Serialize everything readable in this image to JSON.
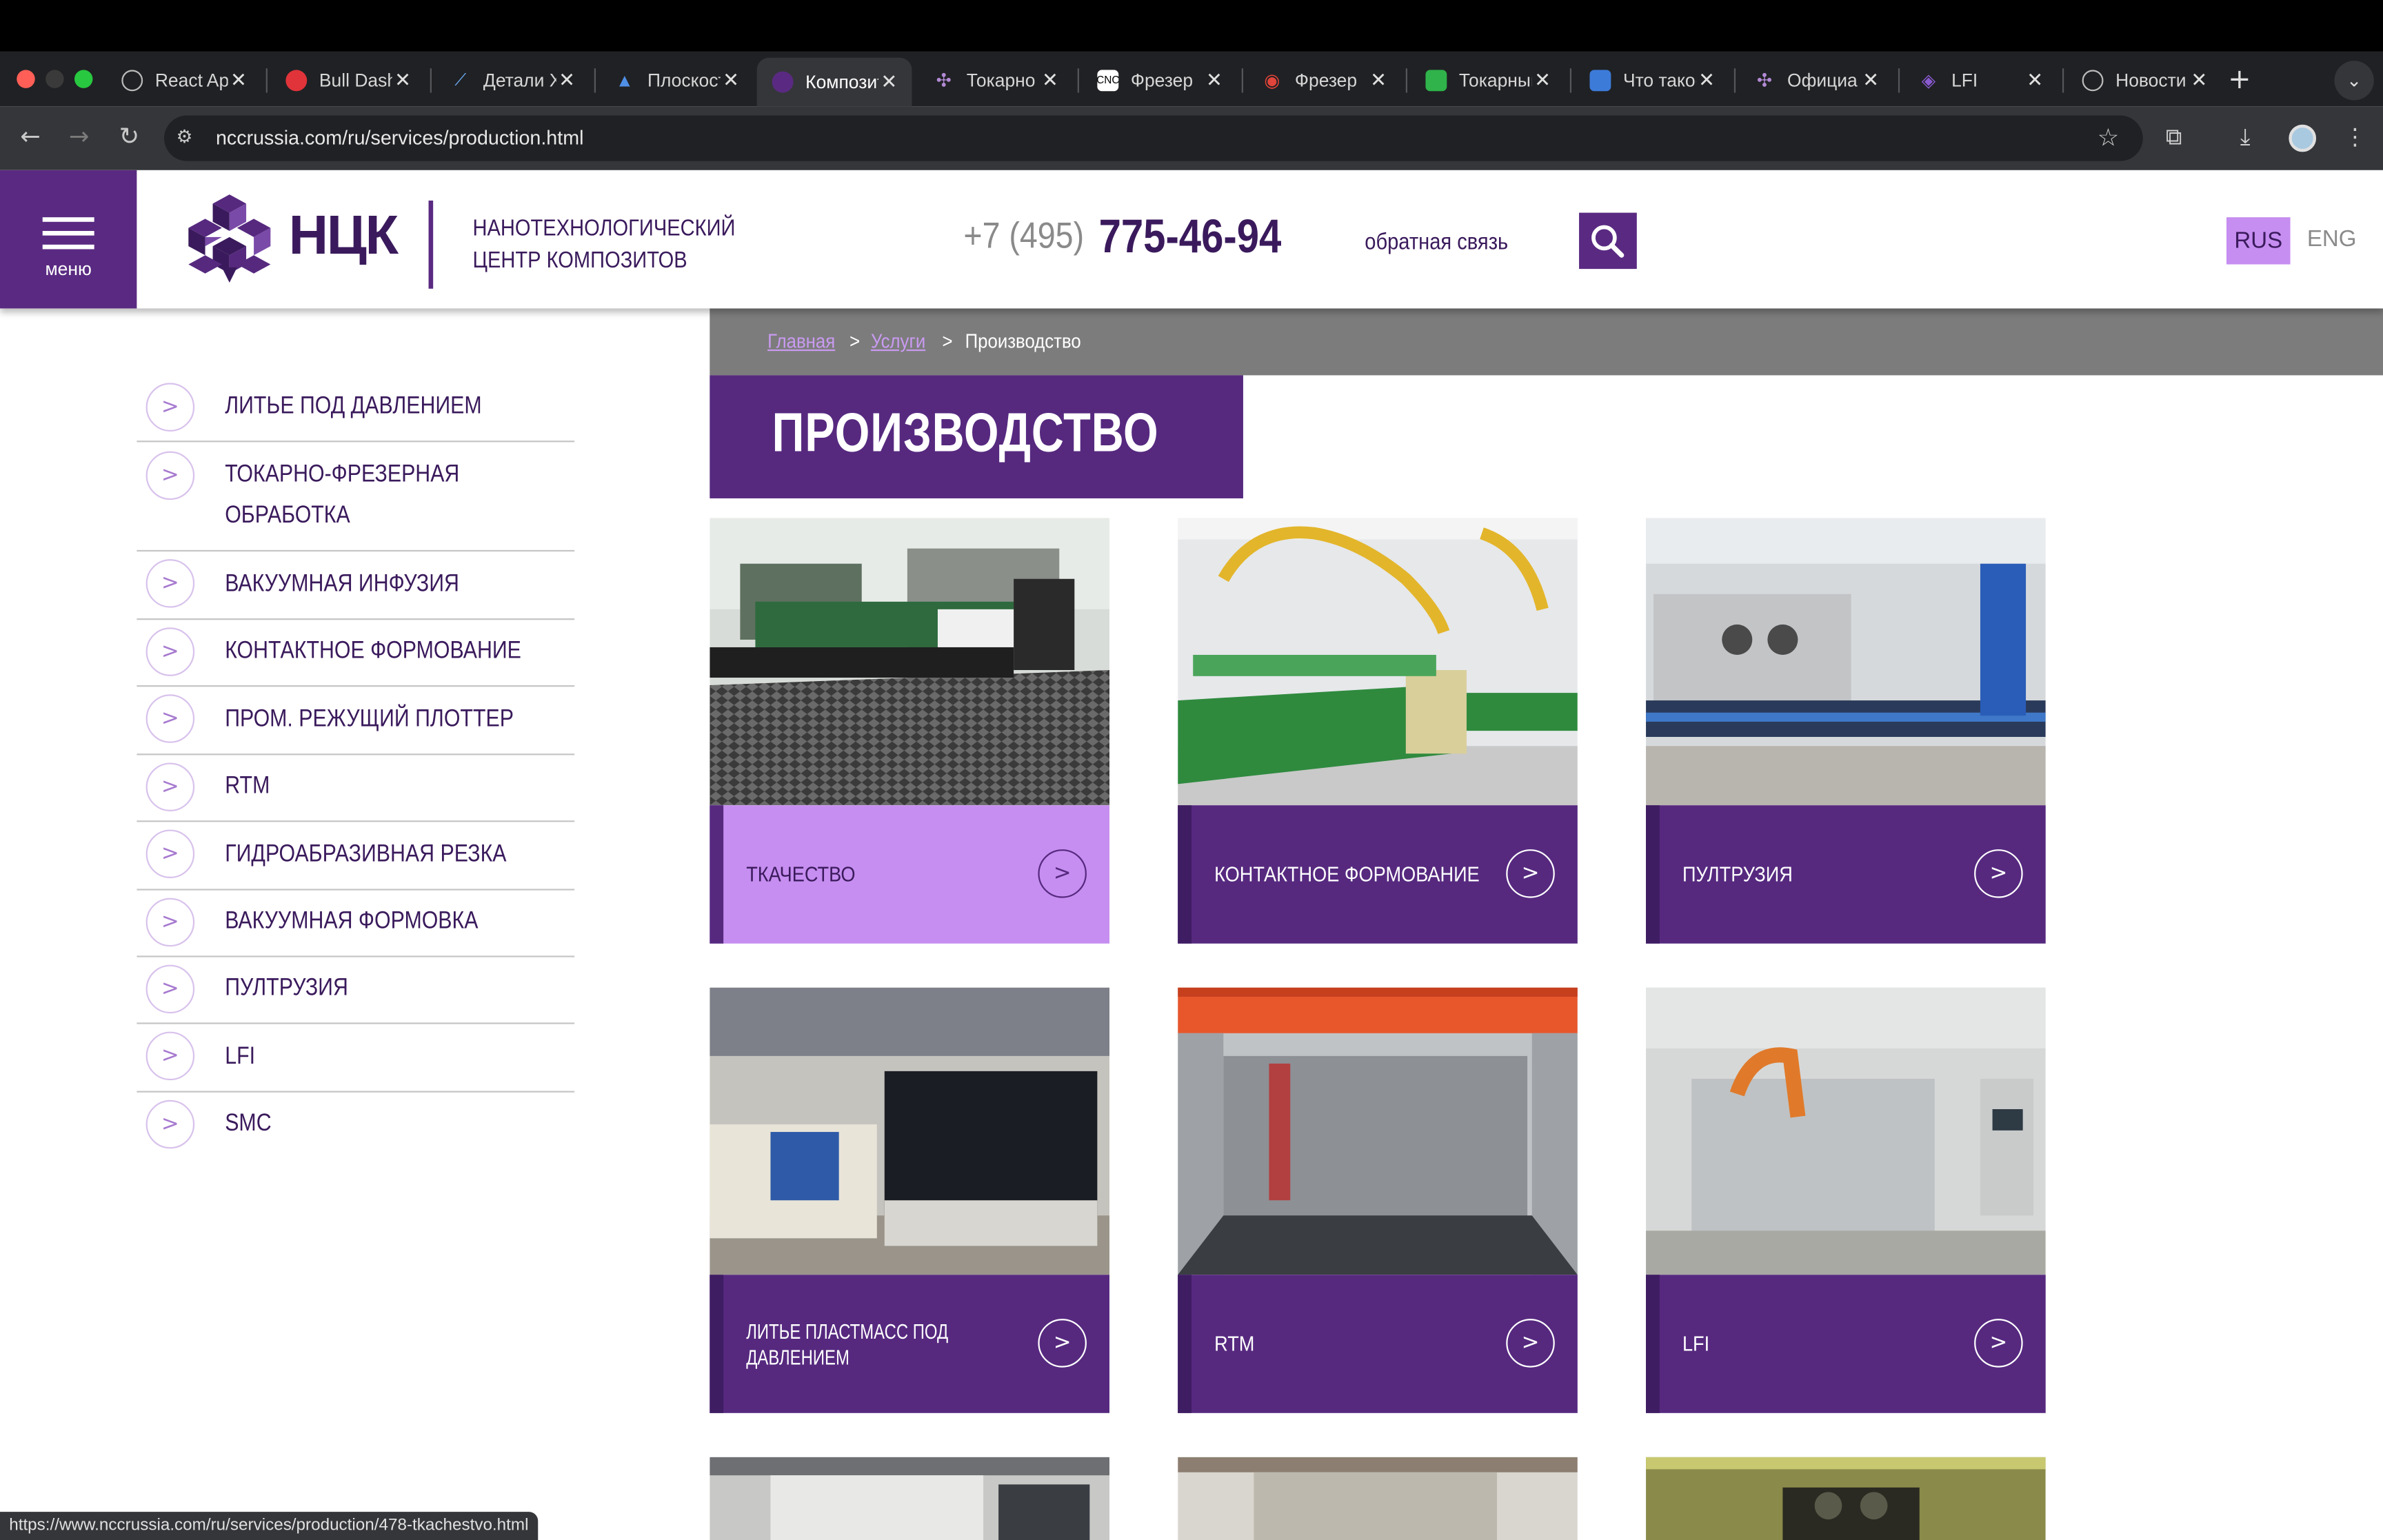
{
  "browser": {
    "tabs": [
      {
        "title": "React App",
        "active": false
      },
      {
        "title": "Bull Dashboard",
        "active": false
      },
      {
        "title": "Детали X",
        "active": false
      },
      {
        "title": "Плоскость",
        "active": false
      },
      {
        "title": "Композиты",
        "active": true
      },
      {
        "title": "Токарно",
        "active": false
      },
      {
        "title": "Фрезер",
        "active": false
      },
      {
        "title": "Фрезер",
        "active": false
      },
      {
        "title": "Токарный",
        "active": false
      },
      {
        "title": "Что такое",
        "active": false
      },
      {
        "title": "Официа",
        "active": false
      },
      {
        "title": "LFI",
        "active": false
      },
      {
        "title": "Новости",
        "active": false
      }
    ],
    "url": "nccrussia.com/ru/services/production.html",
    "status_url": "https://www.nccrussia.com/ru/services/production/478-tkachestvo.html"
  },
  "header": {
    "menu_label": "меню",
    "logo_text": "НЦК",
    "logo_sub_line1": "НАНОТЕХНОЛОГИЧЕСКИЙ",
    "logo_sub_line2": "ЦЕНТР КОМПОЗИТОВ",
    "phone_code": "+7 (495)",
    "phone_number": "775-46-94",
    "feedback": "обратная связь",
    "lang_active": "RUS",
    "lang_other": "ENG"
  },
  "breadcrumb": {
    "home": "Главная",
    "services": "Услуги",
    "current": "Производство",
    "separator": ">"
  },
  "page_title": "ПРОИЗВОДСТВО",
  "sidebar": [
    {
      "label": "ЛИТЬЕ ПОД ДАВЛЕНИЕМ"
    },
    {
      "label_line1": "ТОКАРНО-ФРЕЗЕРНАЯ",
      "label_line2": "ОБРАБОТКА"
    },
    {
      "label": "ВАКУУМНАЯ ИНФУЗИЯ"
    },
    {
      "label": "КОНТАКТНОЕ ФОРМОВАНИЕ"
    },
    {
      "label": "ПРОМ. РЕЖУЩИЙ ПЛОТТЕР"
    },
    {
      "label": "RTM"
    },
    {
      "label": "ГИДРОАБРАЗИВНАЯ РЕЗКА"
    },
    {
      "label": "ВАКУУМНАЯ ФОРМОВКА"
    },
    {
      "label": "ПУЛТРУЗИЯ"
    },
    {
      "label": "LFI"
    },
    {
      "label": "SMC"
    }
  ],
  "cards": [
    {
      "caption": "ТКАЧЕСТВО",
      "highlighted": true
    },
    {
      "caption": "КОНТАКТНОЕ ФОРМОВАНИЕ"
    },
    {
      "caption": "ПУЛТРУЗИЯ"
    },
    {
      "caption_line1": "ЛИТЬЕ ПЛАСТМАСС ПОД",
      "caption_line2": "ДАВЛЕНИЕМ"
    },
    {
      "caption": "RTM"
    },
    {
      "caption": "LFI"
    }
  ],
  "colors": {
    "brand_purple": "#56297f",
    "accent_lilac": "#c68ef0",
    "breadcrumb_bar": "#7c7c7c"
  }
}
